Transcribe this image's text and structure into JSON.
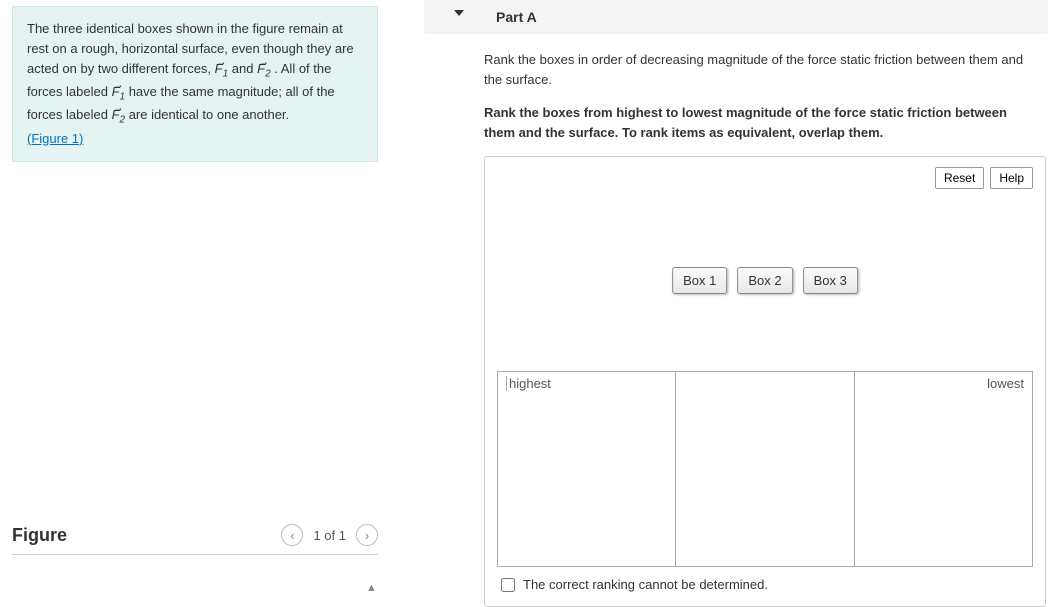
{
  "problem": {
    "line1": "The three identical boxes shown in the figure remain at rest on a rough, horizontal surface, even though they are acted on by two different forces, ",
    "f1": "F",
    "sub1": "1",
    "mid1": " and ",
    "f2": "F",
    "sub2": "2",
    "line2": ". All of the forces labeled ",
    "line3": " have the same magnitude; all of the forces labeled ",
    "line4": " are identical to one another.",
    "figure_link": "(Figure 1)"
  },
  "figure": {
    "title": "Figure",
    "page": "1 of 1"
  },
  "part": {
    "label": "Part A"
  },
  "question": {
    "desc": "Rank the boxes in order of decreasing magnitude of the force static friction between them and the surface.",
    "instr": "Rank the boxes from highest to lowest magnitude of the force static friction between them and the surface. To rank items as equivalent, overlap them."
  },
  "widget": {
    "reset": "Reset",
    "help": "Help",
    "items": [
      "Box 1",
      "Box 2",
      "Box 3"
    ],
    "left_label": "highest",
    "right_label": "lowest",
    "cannot": "The correct ranking cannot be determined."
  }
}
